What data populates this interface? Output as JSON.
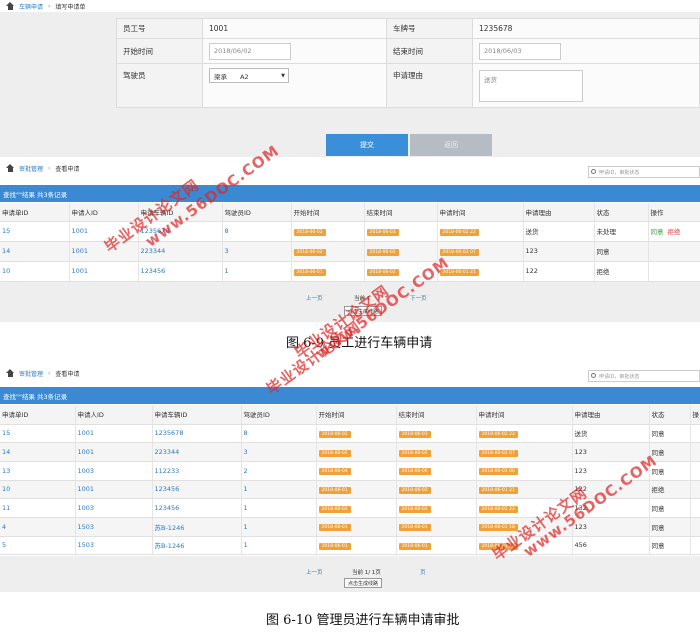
{
  "form_page": {
    "breadcrumb": [
      "车辆申请",
      "填写申请单"
    ],
    "fields": {
      "emp_label": "员工号",
      "emp_value": "1001",
      "plate_label": "车牌号",
      "plate_value": "1235678",
      "start_label": "开始时间",
      "start_value": "2018/06/02",
      "end_label": "结束时间",
      "end_value": "2018/06/03",
      "driver_label": "驾驶员",
      "driver_value": "梁承　　A2",
      "reason_label": "申请理由",
      "reason_value": "送货"
    },
    "submit_label": "提交",
    "back_label": "返回"
  },
  "panel1": {
    "breadcrumb": [
      "审批管理",
      "查看申请"
    ],
    "search_placeholder": "申请ID，审批状态",
    "result_text": "查找\"\"结果 共3条记录",
    "columns": [
      "申请单ID",
      "申请人ID",
      "申请车辆ID",
      "驾驶员ID",
      "开始时间",
      "结束时间",
      "申请时间",
      "申请理由",
      "状态",
      "操作"
    ],
    "rows": [
      {
        "id": "15",
        "emp": "1001",
        "car": "1235678",
        "driver": "8",
        "start": "2018-06-02",
        "end": "2018-06-03",
        "apply": "2018-06-02 22",
        "reason": "送货",
        "status": "未处理",
        "agree": "同意",
        "refuse": "拒绝"
      },
      {
        "id": "14",
        "emp": "1001",
        "car": "223344",
        "driver": "3",
        "start": "2018-06-02",
        "end": "2018-06-02",
        "apply": "2018-06-02 07",
        "reason": "123",
        "status": "同意",
        "agree": "",
        "refuse": ""
      },
      {
        "id": "10",
        "emp": "1001",
        "car": "123456",
        "driver": "1",
        "start": "2018-06-01",
        "end": "2018-06-02",
        "apply": "2018-06-01 21",
        "reason": "122",
        "status": "拒绝",
        "agree": "",
        "refuse": ""
      }
    ],
    "prev": "上一页",
    "page": "当前 1",
    "next": "下一页",
    "gen_btn": "点击生成线路"
  },
  "caption1": "图 6-9 员工进行车辆申请",
  "panel2": {
    "breadcrumb": [
      "审批管理",
      "查看申请"
    ],
    "search_placeholder": "申请ID，审批状态",
    "result_text": "查找\"\"结果 共3条记录",
    "columns": [
      "申请单ID",
      "申请人ID",
      "申请车辆ID",
      "驾驶员ID",
      "开始时间",
      "结束时间",
      "申请时间",
      "申请理由",
      "状态",
      "操"
    ],
    "rows": [
      {
        "id": "15",
        "emp": "1001",
        "car": "1235678",
        "driver": "8",
        "start": "2018-06-02",
        "end": "2018-06-03",
        "apply": "2018-06-02 22",
        "reason": "送货",
        "status": "同意"
      },
      {
        "id": "14",
        "emp": "1001",
        "car": "223344",
        "driver": "3",
        "start": "2018-06-02",
        "end": "2018-06-02",
        "apply": "2018-06-02 07",
        "reason": "123",
        "status": "同意"
      },
      {
        "id": "13",
        "emp": "1003",
        "car": "112233",
        "driver": "2",
        "start": "2018-06-04",
        "end": "2018-06-06",
        "apply": "2018-06-02 00",
        "reason": "123",
        "status": "同意"
      },
      {
        "id": "10",
        "emp": "1001",
        "car": "123456",
        "driver": "1",
        "start": "2018-06-01",
        "end": "2018-06-02",
        "apply": "2018-06-01 21",
        "reason": "122",
        "status": "拒绝"
      },
      {
        "id": "11",
        "emp": "1003",
        "car": "123456",
        "driver": "1",
        "start": "2018-06-02",
        "end": "2018-06-02",
        "apply": "2018-06-01 22",
        "reason": "132",
        "status": "同意"
      },
      {
        "id": "4",
        "emp": "1503",
        "car": "苏B-1246",
        "driver": "1",
        "start": "2018-06-01",
        "end": "2018-06-01",
        "apply": "2018-06-01 18",
        "reason": "123",
        "status": "同意"
      },
      {
        "id": "5",
        "emp": "1503",
        "car": "苏B-1246",
        "driver": "1",
        "start": "2018-06-01",
        "end": "2018-06-01",
        "apply": "2018-06-01 12",
        "reason": "456",
        "status": "同意"
      }
    ],
    "prev": "上一页",
    "page": "当前 1/ 1页",
    "next": "页",
    "gen_btn": "点击生成线路"
  },
  "caption2": "图 6-10 管理员进行车辆申请审批",
  "watermark": {
    "text1": "毕业设计论文网",
    "text2": "www.56DOC.COM"
  }
}
